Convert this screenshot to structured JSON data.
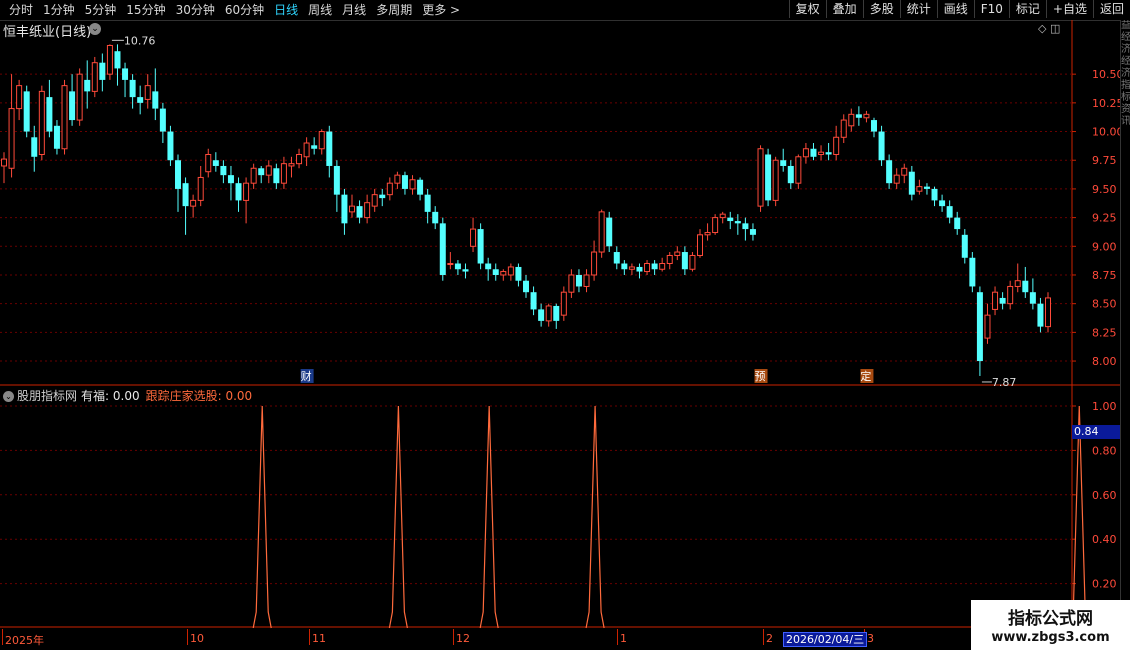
{
  "toolbar": {
    "periods": [
      "分时",
      "1分钟",
      "5分钟",
      "15分钟",
      "30分钟",
      "60分钟",
      "日线",
      "周线",
      "月线",
      "多周期",
      "更多 >"
    ],
    "active_index": 6,
    "buttons": [
      "复权",
      "叠加",
      "多股",
      "统计",
      "画线",
      "F10",
      "标记",
      "+自选",
      "返回"
    ]
  },
  "stock": {
    "title": "恒丰纸业(日线)",
    "high_label": "10.76",
    "low_label": "7.87"
  },
  "price_axis": [
    "10.50",
    "10.25",
    "10.00",
    "9.75",
    "9.50",
    "9.25",
    "9.00",
    "8.75",
    "8.50",
    "8.25",
    "8.00"
  ],
  "event_markers": [
    "财",
    "预",
    "定"
  ],
  "indicator": {
    "name": "股朋指标网",
    "youfu_label": "有福: 0.00",
    "track_label": "跟踪庄家选股: 0.00",
    "axis": [
      "1.00",
      "0.80",
      "0.60",
      "0.40",
      "0.20"
    ],
    "cursor_value": "0.84",
    "signals": [
      1,
      1,
      1,
      1,
      1
    ]
  },
  "date_axis": {
    "labels": [
      "2025年",
      "10",
      "11",
      "12",
      "1",
      "2",
      "3"
    ],
    "selected_date": "2026/02/04/三"
  },
  "watermark": {
    "line1": "指标公式网",
    "line2": "www.zbgs3.com"
  },
  "right_strip_text": "益经济经济指标资讯",
  "colors": {
    "up": "#ff4a3a",
    "down": "#54ffff",
    "grid": "#6a0000",
    "axis": "#cc2200",
    "active_tab": "#2fd6ff"
  },
  "chart_data": {
    "type": "candlestick",
    "ylim": [
      7.8,
      10.85
    ],
    "candles": [
      [
        9.7,
        9.76,
        9.55,
        9.82
      ],
      [
        9.68,
        10.2,
        9.6,
        10.5
      ],
      [
        10.2,
        10.4,
        10.1,
        10.45
      ],
      [
        10.35,
        10.0,
        9.95,
        10.4
      ],
      [
        9.95,
        9.78,
        9.65,
        10.05
      ],
      [
        9.8,
        10.35,
        9.75,
        10.4
      ],
      [
        10.3,
        10.0,
        9.95,
        10.45
      ],
      [
        10.05,
        9.85,
        9.8,
        10.1
      ],
      [
        9.85,
        10.4,
        9.8,
        10.45
      ],
      [
        10.35,
        10.1,
        10.05,
        10.5
      ],
      [
        10.1,
        10.5,
        10.05,
        10.55
      ],
      [
        10.45,
        10.35,
        10.2,
        10.62
      ],
      [
        10.35,
        10.6,
        10.3,
        10.65
      ],
      [
        10.6,
        10.45,
        10.35,
        10.68
      ],
      [
        10.5,
        10.75,
        10.45,
        10.76
      ],
      [
        10.7,
        10.55,
        10.4,
        10.76
      ],
      [
        10.55,
        10.45,
        10.3,
        10.6
      ],
      [
        10.45,
        10.3,
        10.2,
        10.5
      ],
      [
        10.3,
        10.25,
        10.15,
        10.4
      ],
      [
        10.28,
        10.4,
        10.2,
        10.5
      ],
      [
        10.35,
        10.2,
        10.1,
        10.55
      ],
      [
        10.2,
        10.0,
        9.9,
        10.25
      ],
      [
        10.0,
        9.75,
        9.7,
        10.05
      ],
      [
        9.75,
        9.5,
        9.3,
        9.8
      ],
      [
        9.55,
        9.35,
        9.1,
        9.6
      ],
      [
        9.35,
        9.4,
        9.25,
        9.45
      ],
      [
        9.4,
        9.6,
        9.35,
        9.7
      ],
      [
        9.65,
        9.8,
        9.6,
        9.85
      ],
      [
        9.75,
        9.7,
        9.65,
        9.82
      ],
      [
        9.7,
        9.62,
        9.55,
        9.75
      ],
      [
        9.62,
        9.55,
        9.4,
        9.7
      ],
      [
        9.55,
        9.4,
        9.3,
        9.6
      ],
      [
        9.4,
        9.55,
        9.2,
        9.6
      ],
      [
        9.55,
        9.68,
        9.5,
        9.72
      ],
      [
        9.68,
        9.62,
        9.55,
        9.7
      ],
      [
        9.62,
        9.7,
        9.55,
        9.75
      ],
      [
        9.68,
        9.55,
        9.5,
        9.72
      ],
      [
        9.55,
        9.72,
        9.5,
        9.78
      ],
      [
        9.7,
        9.72,
        9.6,
        9.78
      ],
      [
        9.72,
        9.8,
        9.68,
        9.85
      ],
      [
        9.78,
        9.9,
        9.7,
        9.95
      ],
      [
        9.88,
        9.85,
        9.8,
        9.95
      ],
      [
        9.85,
        10.0,
        9.8,
        10.02
      ],
      [
        10.0,
        9.7,
        9.6,
        10.05
      ],
      [
        9.7,
        9.45,
        9.3,
        9.75
      ],
      [
        9.45,
        9.2,
        9.1,
        9.5
      ],
      [
        9.3,
        9.35,
        9.25,
        9.45
      ],
      [
        9.35,
        9.25,
        9.2,
        9.4
      ],
      [
        9.25,
        9.38,
        9.2,
        9.45
      ],
      [
        9.35,
        9.45,
        9.3,
        9.5
      ],
      [
        9.45,
        9.42,
        9.35,
        9.5
      ],
      [
        9.45,
        9.55,
        9.4,
        9.6
      ],
      [
        9.55,
        9.62,
        9.5,
        9.65
      ],
      [
        9.62,
        9.5,
        9.45,
        9.65
      ],
      [
        9.5,
        9.58,
        9.45,
        9.62
      ],
      [
        9.58,
        9.45,
        9.4,
        9.6
      ],
      [
        9.45,
        9.3,
        9.2,
        9.5
      ],
      [
        9.3,
        9.2,
        9.15,
        9.35
      ],
      [
        9.2,
        8.75,
        8.7,
        9.25
      ],
      [
        8.85,
        8.85,
        8.8,
        8.95
      ],
      [
        8.85,
        8.8,
        8.75,
        8.88
      ],
      [
        8.8,
        8.78,
        8.72,
        8.85
      ],
      [
        9.0,
        9.15,
        8.95,
        9.25
      ],
      [
        9.15,
        8.85,
        8.8,
        9.2
      ],
      [
        8.85,
        8.8,
        8.7,
        8.9
      ],
      [
        8.8,
        8.75,
        8.7,
        8.85
      ],
      [
        8.75,
        8.78,
        8.7,
        8.8
      ],
      [
        8.75,
        8.82,
        8.7,
        8.85
      ],
      [
        8.82,
        8.7,
        8.65,
        8.85
      ],
      [
        8.7,
        8.6,
        8.55,
        8.75
      ],
      [
        8.6,
        8.45,
        8.4,
        8.65
      ],
      [
        8.45,
        8.35,
        8.3,
        8.5
      ],
      [
        8.35,
        8.48,
        8.3,
        8.5
      ],
      [
        8.48,
        8.35,
        8.28,
        8.5
      ],
      [
        8.4,
        8.6,
        8.35,
        8.65
      ],
      [
        8.6,
        8.75,
        8.55,
        8.8
      ],
      [
        8.75,
        8.65,
        8.6,
        8.8
      ],
      [
        8.65,
        8.75,
        8.6,
        8.8
      ],
      [
        8.75,
        8.95,
        8.7,
        9.05
      ],
      [
        8.95,
        9.3,
        8.9,
        9.32
      ],
      [
        9.25,
        9.0,
        8.95,
        9.3
      ],
      [
        8.95,
        8.85,
        8.8,
        9.0
      ],
      [
        8.85,
        8.8,
        8.75,
        8.88
      ],
      [
        8.8,
        8.82,
        8.75,
        8.85
      ],
      [
        8.82,
        8.78,
        8.72,
        8.85
      ],
      [
        8.78,
        8.85,
        8.75,
        8.88
      ],
      [
        8.85,
        8.8,
        8.75,
        8.88
      ],
      [
        8.8,
        8.85,
        8.78,
        8.9
      ],
      [
        8.85,
        8.92,
        8.8,
        8.95
      ],
      [
        8.92,
        8.95,
        8.88,
        9.0
      ],
      [
        8.95,
        8.8,
        8.75,
        9.0
      ],
      [
        8.8,
        8.92,
        8.78,
        8.95
      ],
      [
        8.92,
        9.1,
        8.9,
        9.15
      ],
      [
        9.1,
        9.12,
        9.05,
        9.2
      ],
      [
        9.12,
        9.25,
        9.1,
        9.28
      ],
      [
        9.25,
        9.28,
        9.2,
        9.3
      ],
      [
        9.25,
        9.22,
        9.15,
        9.3
      ],
      [
        9.22,
        9.2,
        9.1,
        9.28
      ],
      [
        9.2,
        9.15,
        9.05,
        9.25
      ],
      [
        9.15,
        9.1,
        9.05,
        9.2
      ],
      [
        9.35,
        9.85,
        9.3,
        9.88
      ],
      [
        9.8,
        9.4,
        9.35,
        9.85
      ],
      [
        9.4,
        9.75,
        9.35,
        9.78
      ],
      [
        9.75,
        9.7,
        9.65,
        9.85
      ],
      [
        9.7,
        9.55,
        9.5,
        9.75
      ],
      [
        9.55,
        9.78,
        9.5,
        9.8
      ],
      [
        9.78,
        9.85,
        9.72,
        9.9
      ],
      [
        9.85,
        9.78,
        9.75,
        9.9
      ],
      [
        9.8,
        9.82,
        9.75,
        9.88
      ],
      [
        9.82,
        9.8,
        9.75,
        9.9
      ],
      [
        9.8,
        9.95,
        9.75,
        10.05
      ],
      [
        9.95,
        10.1,
        9.9,
        10.15
      ],
      [
        10.05,
        10.15,
        10.0,
        10.2
      ],
      [
        10.15,
        10.12,
        10.05,
        10.22
      ],
      [
        10.12,
        10.15,
        10.08,
        10.18
      ],
      [
        10.1,
        10.0,
        9.95,
        10.12
      ],
      [
        10.0,
        9.75,
        9.7,
        10.05
      ],
      [
        9.75,
        9.55,
        9.5,
        9.8
      ],
      [
        9.55,
        9.62,
        9.5,
        9.68
      ],
      [
        9.62,
        9.68,
        9.55,
        9.72
      ],
      [
        9.65,
        9.45,
        9.4,
        9.7
      ],
      [
        9.48,
        9.52,
        9.45,
        9.58
      ],
      [
        9.52,
        9.5,
        9.45,
        9.55
      ],
      [
        9.5,
        9.4,
        9.35,
        9.52
      ],
      [
        9.4,
        9.35,
        9.3,
        9.45
      ],
      [
        9.35,
        9.25,
        9.2,
        9.4
      ],
      [
        9.25,
        9.15,
        9.1,
        9.3
      ],
      [
        9.1,
        8.9,
        8.85,
        9.15
      ],
      [
        8.9,
        8.65,
        8.6,
        8.95
      ],
      [
        8.6,
        8.0,
        7.87,
        8.65
      ],
      [
        8.2,
        8.4,
        8.15,
        8.5
      ],
      [
        8.45,
        8.6,
        8.4,
        8.65
      ],
      [
        8.55,
        8.5,
        8.45,
        8.6
      ],
      [
        8.5,
        8.65,
        8.45,
        8.7
      ],
      [
        8.65,
        8.7,
        8.6,
        8.85
      ],
      [
        8.7,
        8.6,
        8.55,
        8.82
      ],
      [
        8.6,
        8.5,
        8.45,
        8.72
      ],
      [
        8.5,
        8.3,
        8.25,
        8.55
      ],
      [
        8.3,
        8.55,
        8.25,
        8.6
      ]
    ]
  }
}
